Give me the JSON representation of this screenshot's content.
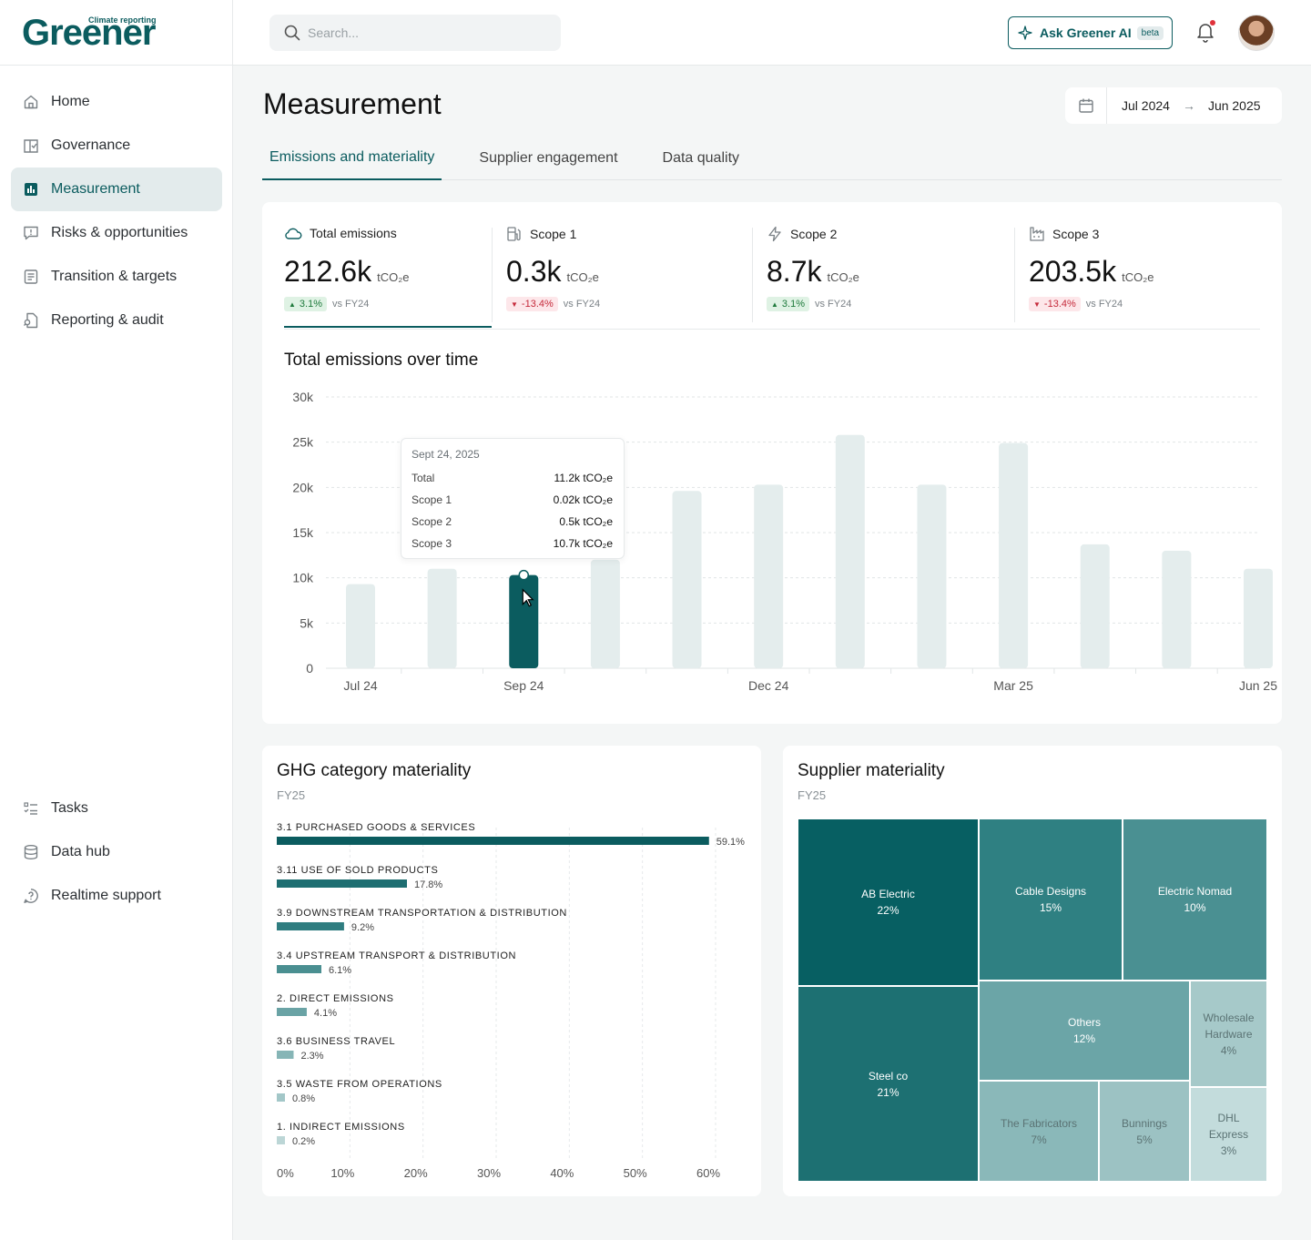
{
  "app": {
    "brand": "Greener",
    "brand_tagline": "Climate reporting"
  },
  "search": {
    "placeholder": "Search..."
  },
  "header": {
    "ask_label": "Ask Greener AI",
    "ask_badge": "beta"
  },
  "sidebar": {
    "items": [
      {
        "label": "Home",
        "icon": "home-icon"
      },
      {
        "label": "Governance",
        "icon": "book-check-icon"
      },
      {
        "label": "Measurement",
        "icon": "bar-chart-icon",
        "active": true
      },
      {
        "label": "Risks & opportunities",
        "icon": "message-alert-icon"
      },
      {
        "label": "Transition & targets",
        "icon": "list-doc-icon"
      },
      {
        "label": "Reporting & audit",
        "icon": "file-search-icon"
      }
    ],
    "bottom_items": [
      {
        "label": "Tasks",
        "icon": "checklist-icon"
      },
      {
        "label": "Data hub",
        "icon": "database-icon"
      },
      {
        "label": "Realtime support",
        "icon": "help-bubble-icon"
      }
    ]
  },
  "page": {
    "title": "Measurement",
    "date_from": "Jul 2024",
    "date_to": "Jun 2025",
    "tabs": [
      "Emissions and materiality",
      "Supplier engagement",
      "Data quality"
    ]
  },
  "kpis": [
    {
      "label": "Total emissions",
      "value": "212.6k",
      "unit": "tCO₂e",
      "delta": "3.1%",
      "direction": "up",
      "compare": "vs FY24",
      "icon": "cloud-icon"
    },
    {
      "label": "Scope 1",
      "value": "0.3k",
      "unit": "tCO₂e",
      "delta": "-13.4%",
      "direction": "down",
      "compare": "vs FY24",
      "icon": "fuel-pump-icon"
    },
    {
      "label": "Scope 2",
      "value": "8.7k",
      "unit": "tCO₂e",
      "delta": "3.1%",
      "direction": "up",
      "compare": "vs FY24",
      "icon": "lightning-icon"
    },
    {
      "label": "Scope 3",
      "value": "203.5k",
      "unit": "tCO₂e",
      "delta": "-13.4%",
      "direction": "down",
      "compare": "vs FY24",
      "icon": "factory-icon"
    }
  ],
  "emissions_chart": {
    "title": "Total emissions over time",
    "tooltip": {
      "date": "Sept 24, 2025",
      "rows": [
        {
          "label": "Total",
          "value": "11.2k tCO₂e"
        },
        {
          "label": "Scope 1",
          "value": "0.02k tCO₂e"
        },
        {
          "label": "Scope 2",
          "value": "0.5k tCO₂e"
        },
        {
          "label": "Scope 3",
          "value": "10.7k tCO₂e"
        }
      ]
    }
  },
  "ghg": {
    "title": "GHG category materiality",
    "subtitle": "FY25"
  },
  "supplier": {
    "title": "Supplier materiality",
    "subtitle": "FY25",
    "tiles": [
      {
        "name": "AB Electric",
        "pct": "22%"
      },
      {
        "name": "Steel co",
        "pct": "21%"
      },
      {
        "name": "Cable Designs",
        "pct": "15%"
      },
      {
        "name": "Electric Nomad",
        "pct": "10%"
      },
      {
        "name": "Others",
        "pct": "12%"
      },
      {
        "name": "Wholesale Hardware",
        "pct": "4%"
      },
      {
        "name": "The Fabricators",
        "pct": "7%"
      },
      {
        "name": "Bunnings",
        "pct": "5%"
      },
      {
        "name": "DHL Express",
        "pct": "3%"
      }
    ]
  },
  "colors": {
    "accent": "#0b5c5f",
    "bar_inactive": "#e4eded",
    "positive": "#1f7a3c",
    "negative": "#c52a3b"
  },
  "chart_data": [
    {
      "type": "bar",
      "title": "Total emissions over time",
      "x_ticks": [
        "Jul 24",
        "Sep 24",
        "Dec 24",
        "Mar 25",
        "Jun 25"
      ],
      "y_ticks": [
        "0",
        "5k",
        "10k",
        "15k",
        "20k",
        "25k",
        "30k"
      ],
      "ylim": [
        0,
        30000
      ],
      "categories": [
        "Jul 24",
        "Aug 24",
        "Sep 24",
        "Oct 24",
        "Nov 24",
        "Dec 24",
        "Jan 25",
        "Feb 25",
        "Mar 25",
        "Apr 25",
        "May 25",
        "Jun 25"
      ],
      "values": [
        9300,
        11000,
        10300,
        12000,
        19600,
        20300,
        25800,
        20300,
        24900,
        13700,
        13000,
        11000
      ],
      "highlighted_index": 2,
      "grid": true
    },
    {
      "type": "bar",
      "orientation": "horizontal",
      "title": "GHG category materiality",
      "categories": [
        "3.1 PURCHASED GOODS & SERVICES",
        "3.11 USE OF SOLD PRODUCTS",
        "3.9 DOWNSTREAM TRANSPORTATION & DISTRIBUTION",
        "3.4 UPSTREAM TRANSPORT & DISTRIBUTION",
        "2. DIRECT EMISSIONS",
        "3.6 BUSINESS TRAVEL",
        "3.5 WASTE FROM OPERATIONS",
        "1. INDIRECT EMISSIONS"
      ],
      "values": [
        59.1,
        17.8,
        9.2,
        6.1,
        4.1,
        2.3,
        0.8,
        0.2
      ],
      "value_labels": [
        "59.1%",
        "17.8%",
        "9.2%",
        "6.1%",
        "4.1%",
        "2.3%",
        "0.8%",
        "0.2%"
      ],
      "x_ticks": [
        "0%",
        "10%",
        "20%",
        "30%",
        "40%",
        "50%",
        "60%"
      ],
      "xlim": [
        0,
        60
      ]
    }
  ]
}
